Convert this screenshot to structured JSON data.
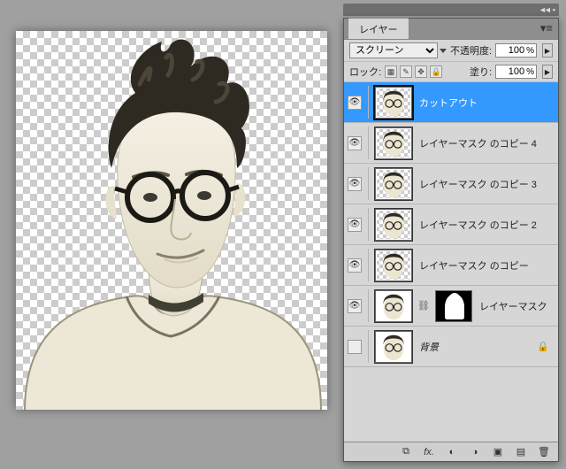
{
  "panel": {
    "title": "レイヤー",
    "blend_mode": "スクリーン",
    "opacity_label": "不透明度:",
    "opacity_value": "100",
    "fill_label": "塗り:",
    "fill_value": "100",
    "lock_label": "ロック:"
  },
  "layers": [
    {
      "name": "カットアウト",
      "visible": true,
      "selected": true,
      "transparent_bg": true,
      "italic": false,
      "has_mask": false,
      "locked": false
    },
    {
      "name": "レイヤーマスク のコピー 4",
      "visible": true,
      "selected": false,
      "transparent_bg": true,
      "italic": false,
      "has_mask": false,
      "locked": false
    },
    {
      "name": "レイヤーマスク のコピー 3",
      "visible": true,
      "selected": false,
      "transparent_bg": true,
      "italic": false,
      "has_mask": false,
      "locked": false
    },
    {
      "name": "レイヤーマスク のコピー 2",
      "visible": true,
      "selected": false,
      "transparent_bg": true,
      "italic": false,
      "has_mask": false,
      "locked": false
    },
    {
      "name": "レイヤーマスク のコピー",
      "visible": true,
      "selected": false,
      "transparent_bg": true,
      "italic": false,
      "has_mask": false,
      "locked": false
    },
    {
      "name": "レイヤーマスク",
      "visible": true,
      "selected": false,
      "transparent_bg": false,
      "italic": false,
      "has_mask": true,
      "locked": false
    },
    {
      "name": "背景",
      "visible": false,
      "selected": false,
      "transparent_bg": false,
      "italic": true,
      "has_mask": false,
      "locked": true
    }
  ],
  "footer_icons": [
    "link",
    "fx",
    "mask",
    "adjust",
    "group",
    "new",
    "trash"
  ]
}
